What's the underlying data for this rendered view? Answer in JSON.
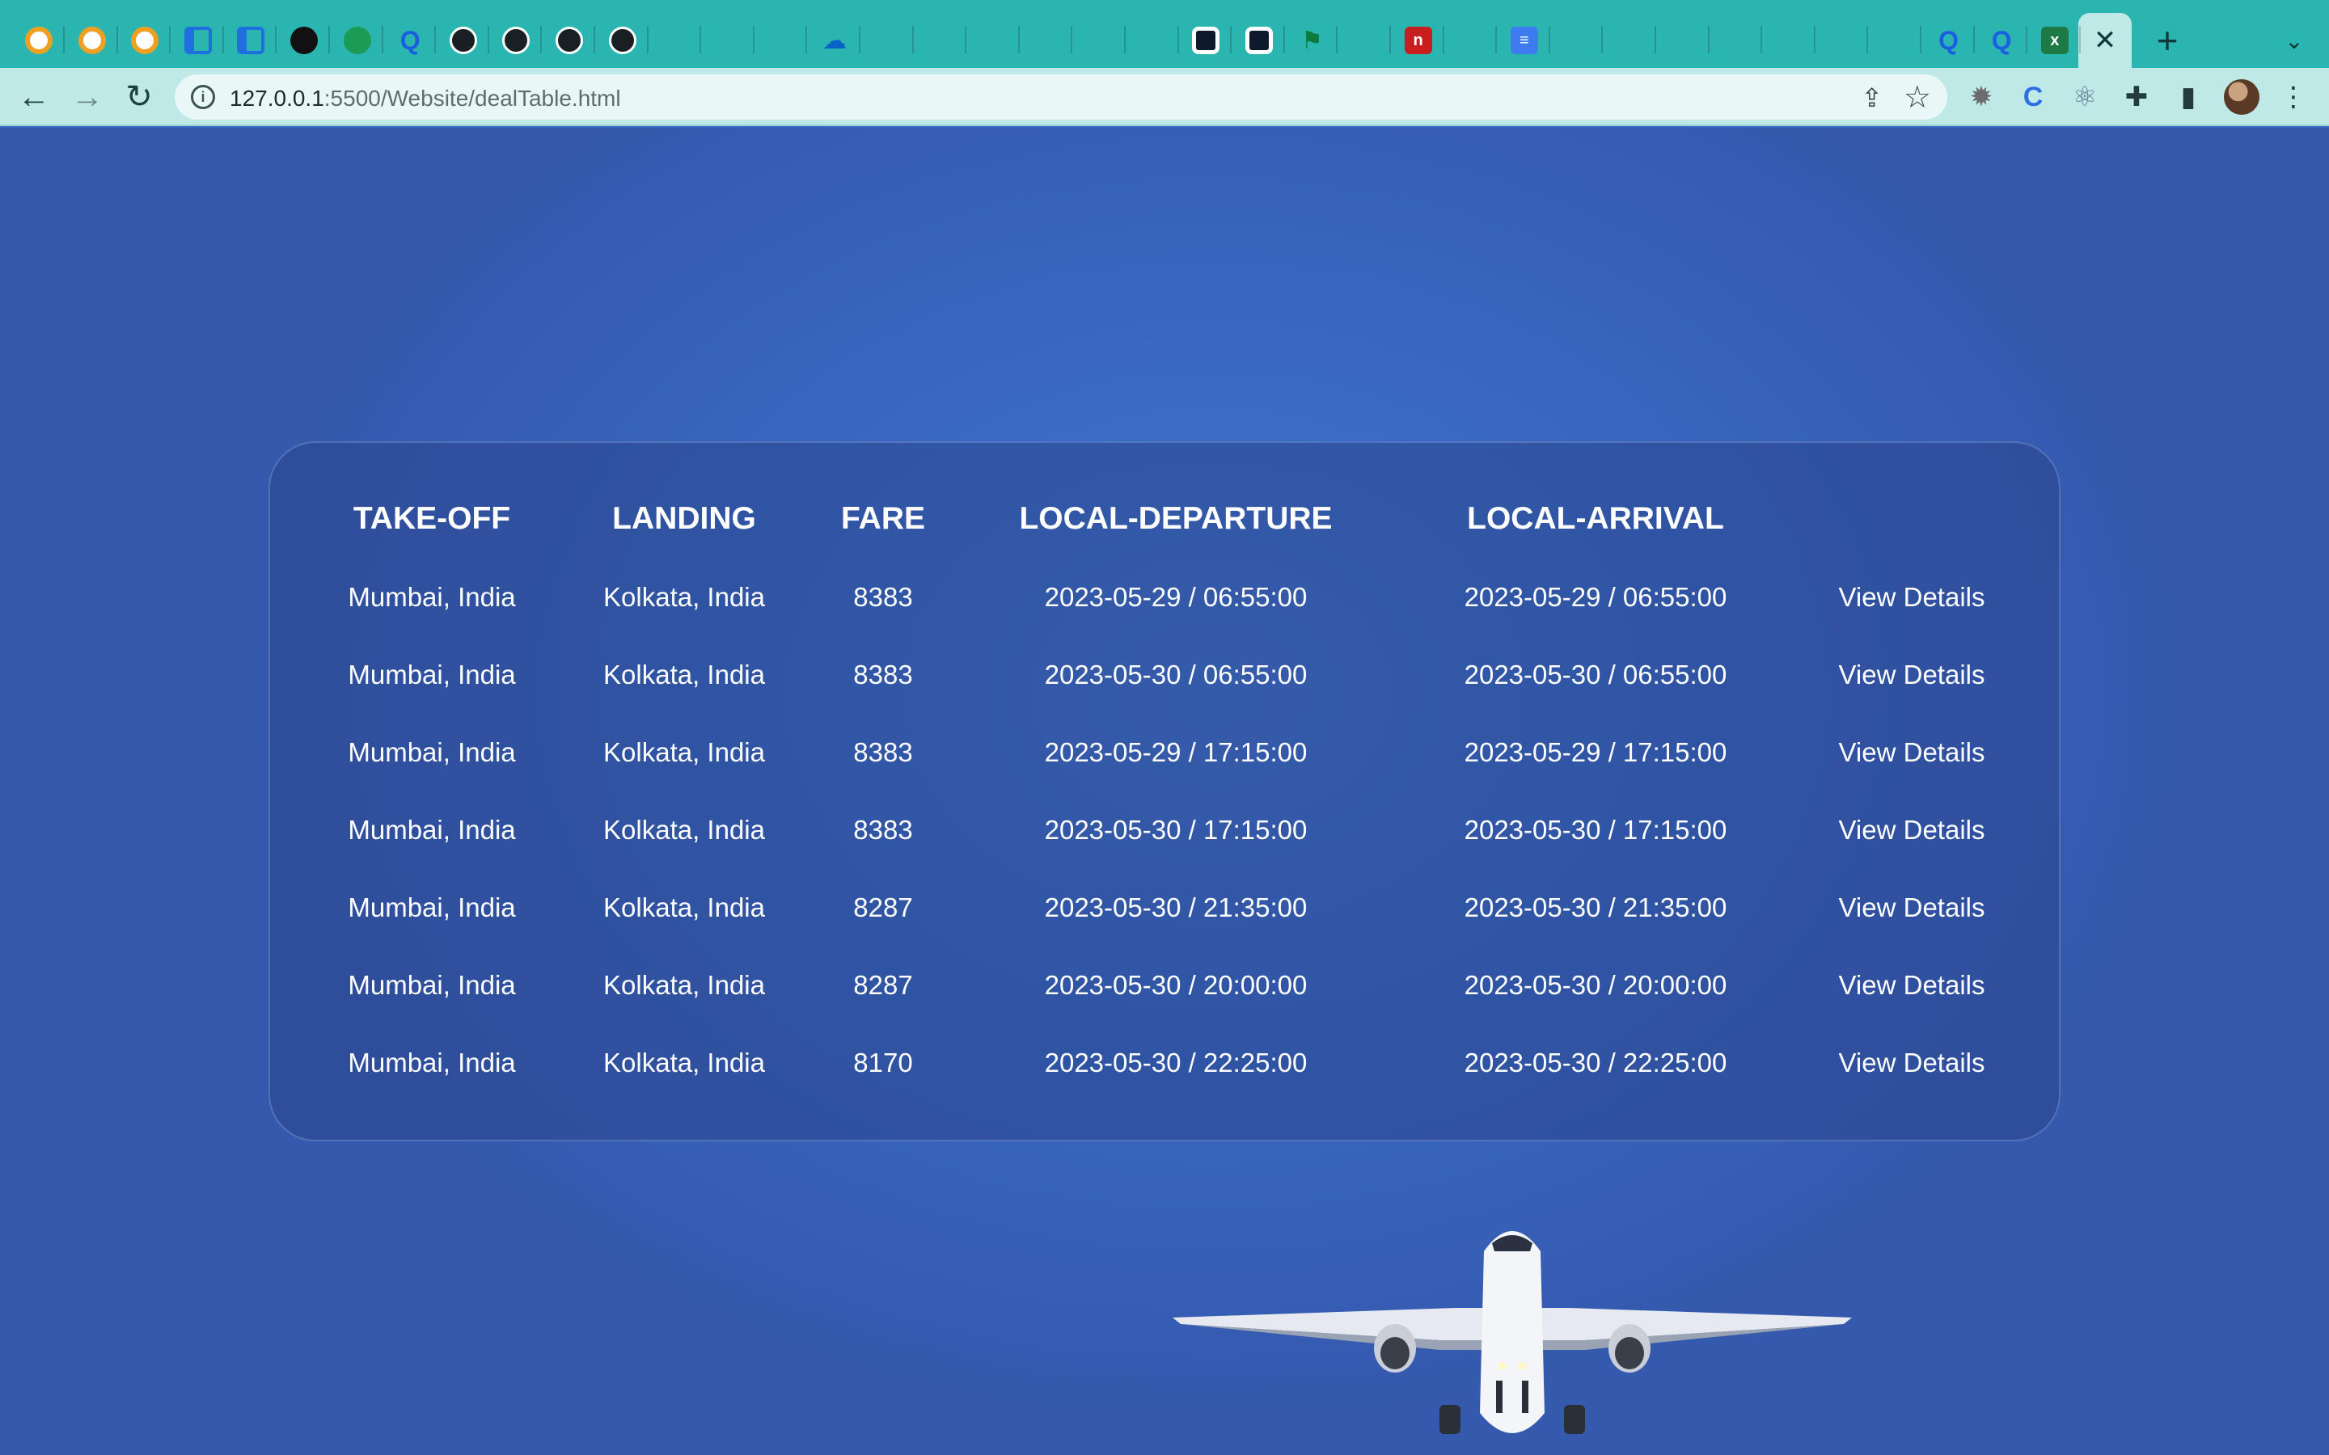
{
  "browser": {
    "tabs": [
      {
        "icon": "bootstrap-icon",
        "color": "#e79d22"
      },
      {
        "icon": "bootstrap-icon",
        "color": "#e79d22"
      },
      {
        "icon": "bootstrap-icon",
        "color": "#e79d22"
      },
      {
        "icon": "sidebar-panel-icon",
        "color": "#1f6fe0"
      },
      {
        "icon": "sidebar-panel-icon",
        "color": "#1f6fe0"
      },
      {
        "icon": "openai-icon",
        "color": "#111111"
      },
      {
        "icon": "green-app-icon",
        "color": "#1b9c54"
      },
      {
        "icon": "blue-q-icon",
        "color": "#1b5fe0"
      },
      {
        "icon": "github-icon",
        "color": "#ffffff"
      },
      {
        "icon": "github-icon",
        "color": "#ffffff"
      },
      {
        "icon": "github-icon",
        "color": "#ffffff"
      },
      {
        "icon": "github-icon",
        "color": "#ffffff"
      },
      {
        "icon": "microsoft-icon",
        "color": ""
      },
      {
        "icon": "microsoft-icon",
        "color": ""
      },
      {
        "icon": "microsoft-icon",
        "color": ""
      },
      {
        "icon": "onedrive-icon",
        "color": "#0a64c8"
      },
      {
        "icon": "microsoft-icon",
        "color": ""
      },
      {
        "icon": "microsoft-icon",
        "color": ""
      },
      {
        "icon": "microsoft-icon",
        "color": ""
      },
      {
        "icon": "microsoft-icon",
        "color": ""
      },
      {
        "icon": "microsoft-icon",
        "color": ""
      },
      {
        "icon": "microsoft-icon",
        "color": ""
      },
      {
        "icon": "dark-pill-icon",
        "color": "#0e1a2b"
      },
      {
        "icon": "dark-pill-icon",
        "color": "#0e1a2b"
      },
      {
        "icon": "green-flag-icon",
        "color": "#0b7a3b"
      },
      {
        "icon": "microsoft-icon",
        "color": ""
      },
      {
        "icon": "red-n-icon",
        "color": "#c81e1e"
      },
      {
        "icon": "microsoft-icon",
        "color": ""
      },
      {
        "icon": "google-docs-icon",
        "color": "#3d7cf0"
      },
      {
        "icon": "microsoft-icon",
        "color": ""
      },
      {
        "icon": "microsoft-icon",
        "color": ""
      },
      {
        "icon": "microsoft-icon",
        "color": ""
      },
      {
        "icon": "microsoft-icon",
        "color": ""
      },
      {
        "icon": "microsoft-icon",
        "color": ""
      },
      {
        "icon": "microsoft-icon",
        "color": ""
      },
      {
        "icon": "microsoft-icon",
        "color": ""
      },
      {
        "icon": "blue-q-icon",
        "color": "#1b5fe0"
      },
      {
        "icon": "blue-q-icon",
        "color": "#1b5fe0"
      },
      {
        "icon": "excel-icon",
        "color": "#1d7a44"
      }
    ],
    "active_tab_close": "✕",
    "new_tab": "+",
    "url_host": "127.0.0.1",
    "url_rest": ":5500/Website/dealTable.html"
  },
  "table": {
    "headers": [
      "TAKE-OFF",
      "LANDING",
      "FARE",
      "LOCAL-DEPARTURE",
      "LOCAL-ARRIVAL"
    ],
    "rows": [
      {
        "takeoff": "Mumbai, India",
        "landing": "Kolkata, India",
        "fare": "8383",
        "departure": "2023-05-29 / 06:55:00",
        "arrival": "2023-05-29 / 06:55:00",
        "action": "View Details"
      },
      {
        "takeoff": "Mumbai, India",
        "landing": "Kolkata, India",
        "fare": "8383",
        "departure": "2023-05-30 / 06:55:00",
        "arrival": "2023-05-30 / 06:55:00",
        "action": "View Details"
      },
      {
        "takeoff": "Mumbai, India",
        "landing": "Kolkata, India",
        "fare": "8383",
        "departure": "2023-05-29 / 17:15:00",
        "arrival": "2023-05-29 / 17:15:00",
        "action": "View Details"
      },
      {
        "takeoff": "Mumbai, India",
        "landing": "Kolkata, India",
        "fare": "8383",
        "departure": "2023-05-30 / 17:15:00",
        "arrival": "2023-05-30 / 17:15:00",
        "action": "View Details"
      },
      {
        "takeoff": "Mumbai, India",
        "landing": "Kolkata, India",
        "fare": "8287",
        "departure": "2023-05-30 / 21:35:00",
        "arrival": "2023-05-30 / 21:35:00",
        "action": "View Details"
      },
      {
        "takeoff": "Mumbai, India",
        "landing": "Kolkata, India",
        "fare": "8287",
        "departure": "2023-05-30 / 20:00:00",
        "arrival": "2023-05-30 / 20:00:00",
        "action": "View Details"
      },
      {
        "takeoff": "Mumbai, India",
        "landing": "Kolkata, India",
        "fare": "8170",
        "departure": "2023-05-30 / 22:25:00",
        "arrival": "2023-05-30 / 22:25:00",
        "action": "View Details"
      }
    ]
  }
}
